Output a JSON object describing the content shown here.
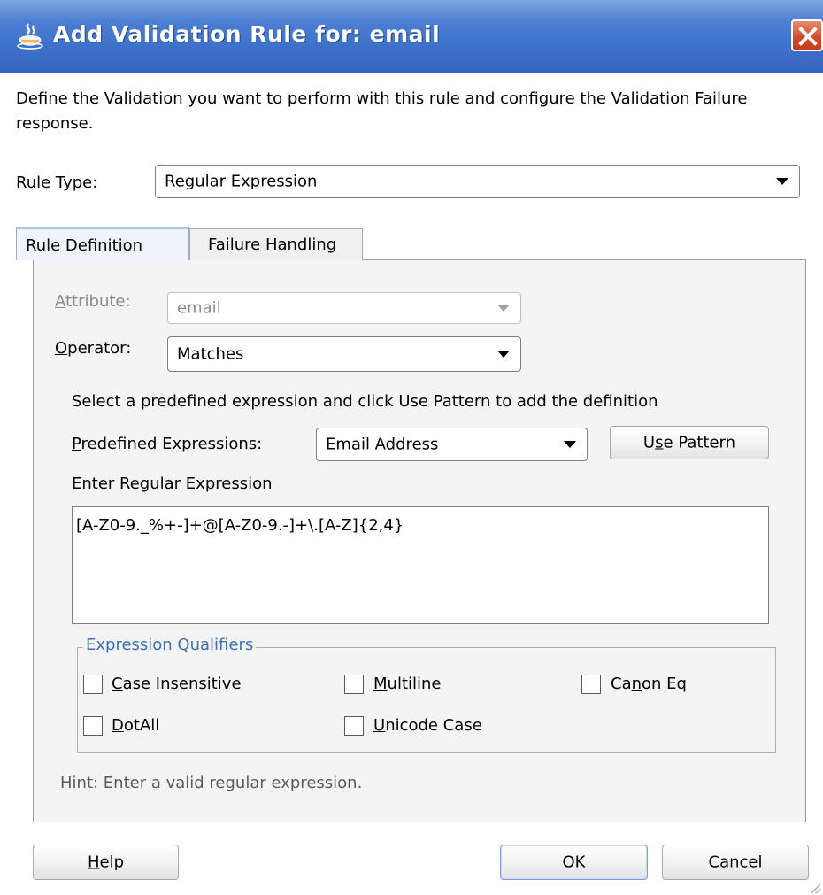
{
  "dialog": {
    "title": "Add Validation Rule for: email",
    "intro": "Define the Validation you want to perform with this rule and configure the Validation Failure response."
  },
  "rule_type": {
    "label_prefix": "",
    "label_u": "R",
    "label_rest": "ule Type:",
    "value": "Regular Expression"
  },
  "tabs": {
    "rule_definition": "Rule Definition",
    "failure_handling": "Failure Handling"
  },
  "attribute": {
    "label_u": "A",
    "label_rest": "ttribute:",
    "value": "email"
  },
  "operator": {
    "label_u": "O",
    "label_rest": "perator:",
    "value": "Matches"
  },
  "predefined": {
    "instruction": "Select a predefined expression and click Use Pattern to add the definition",
    "label_u": "P",
    "label_rest": "redefined Expressions:",
    "value": "Email Address",
    "use_pattern_pre": "U",
    "use_pattern_u": "s",
    "use_pattern_post": "e Pattern"
  },
  "regex": {
    "label_u": "E",
    "label_rest": "nter Regular Expression",
    "value": "[A-Z0-9._%+-]+@[A-Z0-9.-]+\\.[A-Z]{2,4}"
  },
  "qualifiers": {
    "legend": "Expression Qualifiers",
    "case_insensitive_u": "C",
    "case_insensitive_rest": "ase Insensitive",
    "multiline_u": "M",
    "multiline_rest": "ultiline",
    "canon_eq_pre": "Ca",
    "canon_eq_u": "n",
    "canon_eq_post": "on Eq",
    "dotall_u": "D",
    "dotall_rest": "otAll",
    "unicode_case_u": "U",
    "unicode_case_rest": "nicode Case"
  },
  "hint": "Hint: Enter a valid regular expression.",
  "buttons": {
    "help_u": "H",
    "help_rest": "elp",
    "ok": "OK",
    "cancel": "Cancel"
  }
}
